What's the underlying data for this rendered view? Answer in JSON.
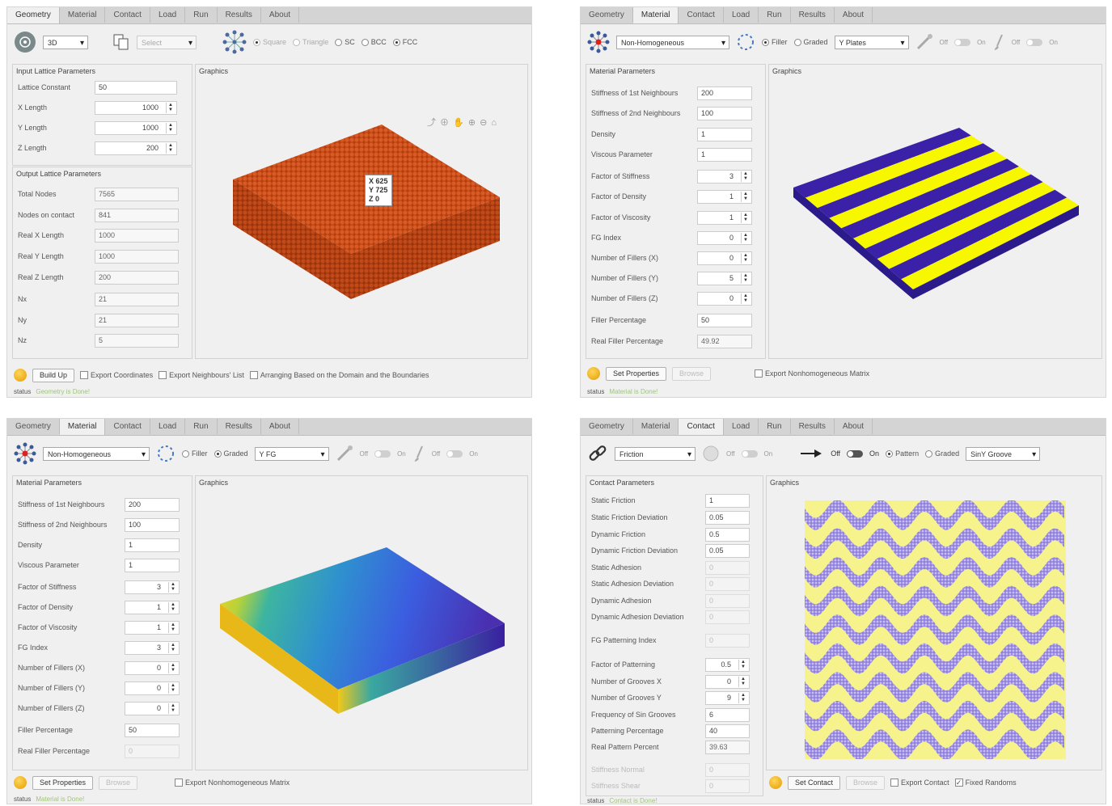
{
  "tabs": [
    "Geometry",
    "Material",
    "Contact",
    "Load",
    "Run",
    "Results",
    "About"
  ],
  "colors": {
    "lattice": "#c94a1a",
    "filler_yellow": "#f7f700",
    "matrix_blue": "#3a21a8",
    "graded_top": "#ffd21e",
    "graded_mid": "#3db5a0",
    "graded_low": "#4a3ad6",
    "pattern_yellow": "#f6f28c",
    "pattern_purple": "#8573d8"
  },
  "w1": {
    "active_tab": "Geometry",
    "toolbar": {
      "dim": "3D",
      "select": "Select",
      "opts": [
        "Square",
        "Triangle",
        "SC",
        "BCC",
        "FCC"
      ],
      "checked": "FCC"
    },
    "input_title": "Input Lattice Parameters",
    "inputs": [
      {
        "label": "Lattice Constant",
        "value": "50"
      },
      {
        "label": "X Length",
        "value": "1000"
      },
      {
        "label": "Y Length",
        "value": "1000"
      },
      {
        "label": "Z Length",
        "value": "200"
      }
    ],
    "output_title": "Output Lattice Parameters",
    "outputs": [
      {
        "label": "Total Nodes",
        "value": "7565"
      },
      {
        "label": "Nodes on contact",
        "value": "841"
      },
      {
        "label": "Real X Length",
        "value": "1000"
      },
      {
        "label": "Real Y Length",
        "value": "1000"
      },
      {
        "label": "Real Z Length",
        "value": "200"
      },
      {
        "label": "Nx",
        "value": "21"
      },
      {
        "label": "Ny",
        "value": "21"
      },
      {
        "label": "Nz",
        "value": "5"
      }
    ],
    "graphics_title": "Graphics",
    "readout": {
      "x": "X 625",
      "y": "Y 725",
      "z": "Z 0"
    },
    "bottom": {
      "button": "Build Up",
      "c1": "Export Coordinates",
      "c2": "Export Neighbours' List",
      "c3": "Arranging Based on the Domain and the Boundaries"
    },
    "status_label": "status",
    "status_value": "Geometry is Done!"
  },
  "w2": {
    "active_tab": "Material",
    "toolbar": {
      "mode": "Non-Homogeneous",
      "r1": "Filler",
      "r2": "Graded",
      "pattern": "Y Plates",
      "off": "Off",
      "on": "On"
    },
    "params_title": "Material Parameters",
    "params": [
      {
        "label": "Stiffness of 1st Neighbours",
        "value": "200"
      },
      {
        "label": "Stiffness of 2nd Neighbours",
        "value": "100"
      },
      {
        "label": "Density",
        "value": "1"
      },
      {
        "label": "Viscous Parameter",
        "value": "1"
      },
      {
        "label": "Factor of Stiffness",
        "value": "3"
      },
      {
        "label": "Factor of Density",
        "value": "1"
      },
      {
        "label": "Factor of Viscosity",
        "value": "1"
      },
      {
        "label": "FG Index",
        "value": "0"
      },
      {
        "label": "Number of Fillers (X)",
        "value": "0"
      },
      {
        "label": "Number of Fillers (Y)",
        "value": "5"
      },
      {
        "label": "Number of Fillers (Z)",
        "value": "0"
      },
      {
        "label": "Filler Percentage",
        "value": "50"
      },
      {
        "label": "Real Filler Percentage",
        "value": "49.92"
      }
    ],
    "graphics_title": "Graphics",
    "bottom": {
      "button": "Set Properties",
      "browse": "Browse",
      "c1": "Export Nonhomogeneous Matrix"
    },
    "status_label": "status",
    "status_value": "Material is Done!"
  },
  "w3": {
    "active_tab": "Material",
    "toolbar": {
      "mode": "Non-Homogeneous",
      "r1": "Filler",
      "r2": "Graded",
      "pattern": "Y FG",
      "off": "Off",
      "on": "On"
    },
    "params_title": "Material Parameters",
    "params": [
      {
        "label": "Stiffness of 1st Neighbours",
        "value": "200"
      },
      {
        "label": "Stiffness of 2nd Neighbours",
        "value": "100"
      },
      {
        "label": "Density",
        "value": "1"
      },
      {
        "label": "Viscous Parameter",
        "value": "1"
      },
      {
        "label": "Factor of Stiffness",
        "value": "3"
      },
      {
        "label": "Factor of Density",
        "value": "1"
      },
      {
        "label": "Factor of Viscosity",
        "value": "1"
      },
      {
        "label": "FG Index",
        "value": "3"
      },
      {
        "label": "Number of Fillers (X)",
        "value": "0"
      },
      {
        "label": "Number of Fillers (Y)",
        "value": "0"
      },
      {
        "label": "Number of Fillers (Z)",
        "value": "0"
      },
      {
        "label": "Filler Percentage",
        "value": "50"
      },
      {
        "label": "Real Filler Percentage",
        "value": "0"
      }
    ],
    "graphics_title": "Graphics",
    "bottom": {
      "button": "Set Properties",
      "browse": "Browse",
      "c1": "Export Nonhomogeneous Matrix"
    },
    "status_label": "status",
    "status_value": "Material is Done!"
  },
  "w4": {
    "active_tab": "Contact",
    "toolbar": {
      "mode": "Friction",
      "off": "Off",
      "on": "On",
      "r1": "Pattern",
      "r2": "Graded",
      "pattern": "SinY Groove"
    },
    "params_title": "Contact Parameters",
    "params": [
      {
        "label": "Static Friction",
        "value": "1"
      },
      {
        "label": "Static Friction Deviation",
        "value": "0.05"
      },
      {
        "label": "Dynamic Friction",
        "value": "0.5"
      },
      {
        "label": "Dynamic Friction Deviation",
        "value": "0.05"
      },
      {
        "label": "Static Adhesion",
        "value": "0"
      },
      {
        "label": "Static Adhesion Deviation",
        "value": "0"
      },
      {
        "label": "Dynamic Adhesion",
        "value": "0"
      },
      {
        "label": "Dynamic Adhesion Deviation",
        "value": "0"
      },
      {
        "label": "FG Patterning Index",
        "value": "0"
      },
      {
        "label": "Factor of Patterning",
        "value": "0.5"
      },
      {
        "label": "Number of Grooves X",
        "value": "0"
      },
      {
        "label": "Number of Grooves Y",
        "value": "9"
      },
      {
        "label": "Frequency of Sin Grooves",
        "value": "6"
      },
      {
        "label": "Patterning Percentage",
        "value": "40"
      },
      {
        "label": "Real Pattern Percent",
        "value": "39.63"
      },
      {
        "label": "Stiffness Normal",
        "value": "0"
      },
      {
        "label": "Stiffness Shear",
        "value": "0"
      }
    ],
    "graphics_title": "Graphics",
    "bottom": {
      "button": "Set Contact",
      "browse": "Browse",
      "c1": "Export Contact",
      "c2": "Fixed Randoms"
    },
    "status_label": "status",
    "status_value": "Contact is Done!"
  }
}
